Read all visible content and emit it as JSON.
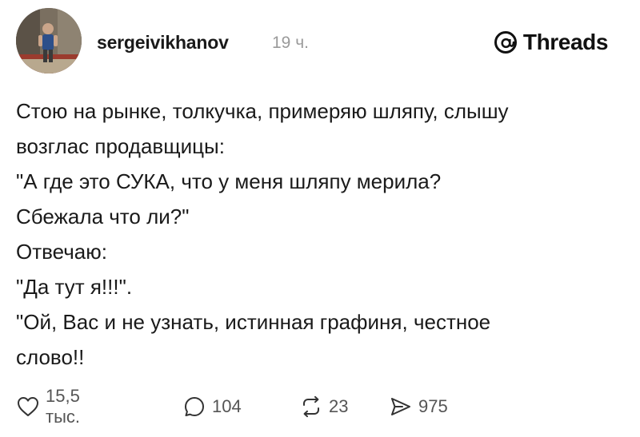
{
  "post": {
    "author": {
      "username": "sergeivikhanov",
      "time_ago": "19 ч."
    },
    "brand": {
      "name": "Threads",
      "icon": "threads-logo-icon"
    },
    "text_lines": [
      "Стою на рынке, толкучка, примеряю шляпу, слышу",
      "возглас продавщицы:",
      "\"А где это СУКА, что у меня шляпу мерила?",
      "Сбежала что ли?\"",
      "Отвечаю:",
      "\"Да тут я!!!\".",
      "\"Ой, Вас и не узнать, истинная графиня, честное",
      "слово!!"
    ],
    "actions": {
      "likes": {
        "count": "15,5 тыс.",
        "icon": "heart-icon"
      },
      "comments": {
        "count": "104",
        "icon": "comment-icon"
      },
      "reposts": {
        "count": "23",
        "icon": "repost-icon"
      },
      "shares": {
        "count": "975",
        "icon": "send-icon"
      }
    }
  }
}
